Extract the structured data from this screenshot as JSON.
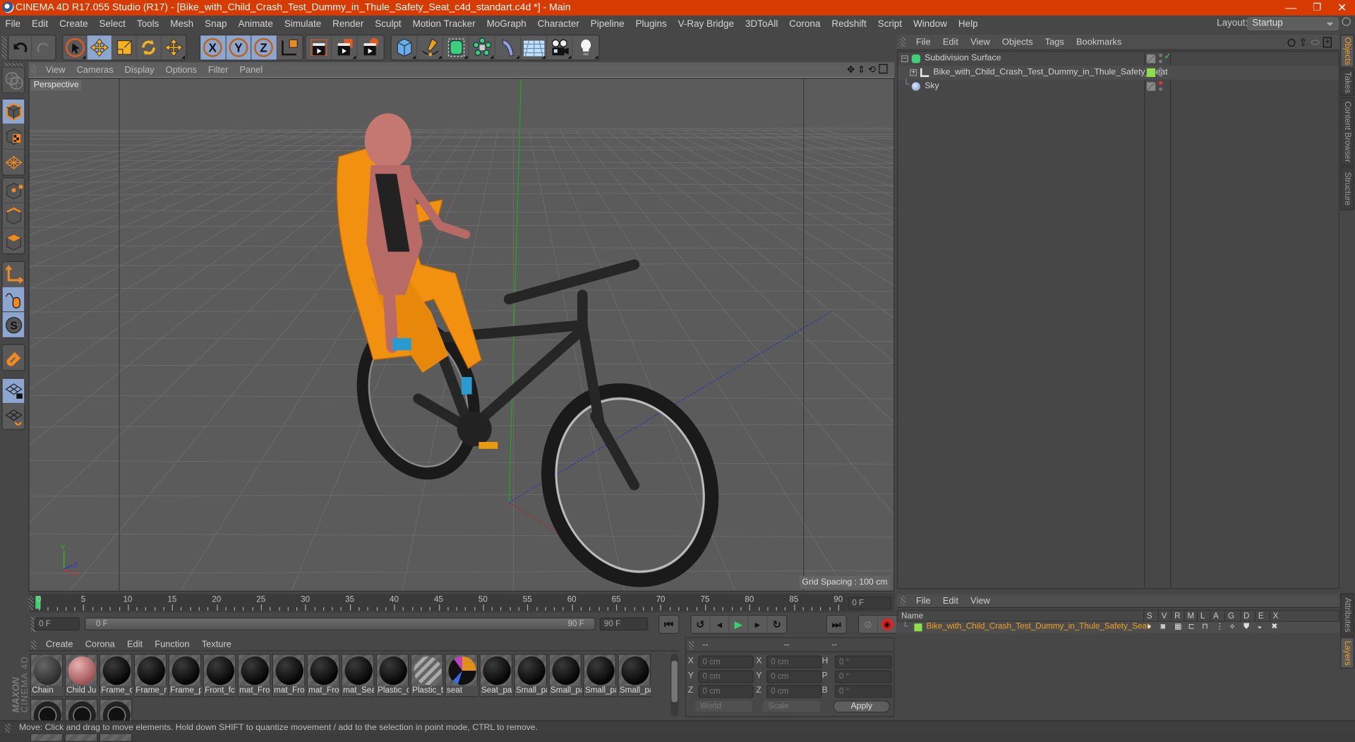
{
  "window": {
    "title": "CINEMA 4D R17.055 Studio (R17) - [Bike_with_Child_Crash_Test_Dummy_in_Thule_Safety_Seat_c4d_standart.c4d *] - Main",
    "controls": {
      "minimize": "—",
      "restore": "❐",
      "close": "✕"
    }
  },
  "menubar": {
    "items": [
      "File",
      "Edit",
      "Create",
      "Select",
      "Tools",
      "Mesh",
      "Snap",
      "Animate",
      "Simulate",
      "Render",
      "Sculpt",
      "Motion Tracker",
      "MoGraph",
      "Character",
      "Pipeline",
      "Plugins",
      "V-Ray Bridge",
      "3DToAll",
      "Corona",
      "Redshift",
      "Script",
      "Window",
      "Help"
    ],
    "layout_label": "Layout:",
    "layout_value": "Startup"
  },
  "toolbar": {
    "undo": "undo-icon",
    "redo": "redo-icon",
    "tools": [
      "select-arrow-icon",
      "move-icon",
      "scale-icon",
      "rotate-icon",
      "recent-tool-move-icon"
    ],
    "axis": [
      "X",
      "Y",
      "Z"
    ],
    "coordinate_system": "world-coordinate-icon",
    "render": [
      "render-view-icon",
      "render-picture-viewer-icon",
      "render-settings-icon"
    ],
    "create": [
      "cube-icon",
      "pen-spline-icon",
      "subdivision-icon",
      "cloner-icon",
      "deformer-icon",
      "floor-icon",
      "camera-icon",
      "light-icon"
    ]
  },
  "left_toolbar": [
    "make-editable-icon",
    "model-mode-icon",
    "texture-mode-icon",
    "workplane-icon",
    "points-mode-icon",
    "edges-mode-icon",
    "polygons-mode-icon",
    "axis-mode-icon",
    "tweak-mode-icon",
    "solo-icon",
    "snap-magnet-icon",
    "workplane-lock-icon",
    "workplane-align-icon"
  ],
  "viewport": {
    "menu": [
      "View",
      "Cameras",
      "Display",
      "Options",
      "Filter",
      "Panel"
    ],
    "camera_label": "Perspective",
    "grid_spacing": "Grid Spacing : 100 cm",
    "axis_labels": {
      "x": "X",
      "y": "Y",
      "z": "Z"
    }
  },
  "object_manager": {
    "menu": [
      "File",
      "Edit",
      "View",
      "Objects",
      "Tags",
      "Bookmarks"
    ],
    "objects": [
      {
        "name": "Subdivision Surface",
        "depth": 0,
        "expand": "−",
        "icon": "subdivision-surface-icon",
        "enabled_check": true
      },
      {
        "name": "Bike_with_Child_Crash_Test_Dummy_in_Thule_Safety_Seat",
        "depth": 1,
        "expand": "+",
        "icon": "null-object-icon",
        "layer_color": "#8ee04a"
      },
      {
        "name": "Sky",
        "depth": 0,
        "expand": "",
        "icon": "sky-icon",
        "red_dot": true
      }
    ]
  },
  "right_tabs": {
    "top": [
      {
        "label": "Objects",
        "active": true
      },
      {
        "label": "Takes",
        "active": false
      },
      {
        "label": "Content Browser",
        "active": false
      },
      {
        "label": "Structure",
        "active": false
      }
    ],
    "bottom": [
      {
        "label": "Attributes",
        "active": false
      },
      {
        "label": "Layers",
        "active": true
      }
    ]
  },
  "timeline": {
    "ticks": [
      "0",
      "5",
      "10",
      "15",
      "20",
      "25",
      "30",
      "35",
      "40",
      "45",
      "50",
      "55",
      "60",
      "65",
      "70",
      "75",
      "80",
      "85",
      "90"
    ],
    "current_frame_field": "0 F",
    "start_field": "0 F",
    "range_start": "0 F",
    "range_end": "90 F",
    "end_field": "90 F"
  },
  "playback": {
    "buttons": [
      "go-to-start-icon",
      "previous-key-icon",
      "previous-frame-icon",
      "play-icon",
      "next-frame-icon",
      "next-key-icon",
      "go-to-end-icon"
    ],
    "record": [
      "autokey-disabled-icon",
      "record-icon",
      "keyframe-help-icon"
    ],
    "key_tracks": [
      "key-position-icon",
      "key-scale-icon",
      "key-rotation-icon",
      "key-parameter-icon",
      "key-pla-icon"
    ],
    "timeline_button": "timeline-icon"
  },
  "material_manager": {
    "menu": [
      "Create",
      "Corona",
      "Edit",
      "Function",
      "Texture"
    ],
    "materials": [
      "Chain",
      "Child Ju",
      "Frame_c",
      "Frame_n",
      "Frame_p",
      "Front_fc",
      "mat_Fro",
      "mat_Fro",
      "mat_Fro",
      "mat_Sea",
      "Plastic_c",
      "Plastic_t",
      "seat",
      "Seat_pa",
      "Small_pa",
      "Small_pa",
      "Small_pa",
      "Small_pa",
      "",
      "",
      ""
    ]
  },
  "coordinates": {
    "headers": [
      "--",
      "--",
      "--"
    ],
    "rows": [
      {
        "a": "X",
        "av": "0 cm",
        "b": "X",
        "bv": "0 cm",
        "c": "H",
        "cv": "0 °"
      },
      {
        "a": "Y",
        "av": "0 cm",
        "b": "Y",
        "bv": "0 cm",
        "c": "P",
        "cv": "0 °"
      },
      {
        "a": "Z",
        "av": "0 cm",
        "b": "Z",
        "bv": "0 cm",
        "c": "B",
        "cv": "0 °"
      }
    ],
    "mode": "World",
    "transform": "Scale",
    "apply": "Apply"
  },
  "layer_manager": {
    "menu": [
      "File",
      "Edit",
      "View"
    ],
    "columns": [
      "Name",
      "S",
      "V",
      "R",
      "M",
      "L",
      "A",
      "G",
      "D",
      "E",
      "X"
    ],
    "layers": [
      {
        "name": "Bike_with_Child_Crash_Test_Dummy_in_Thule_Safety_Seat",
        "color": "#8ee04a"
      }
    ]
  },
  "status_bar": "Move: Click and drag to move elements. Hold down SHIFT to quantize movement / add to the selection in point mode, CTRL to remove.",
  "branding": {
    "maxon": "MAXON",
    "product": "CINEMA 4D"
  },
  "colors": {
    "title_bar": "#d83b01",
    "selected_tool": "#8ca6cf",
    "accent_orange": "#f0a020",
    "layer_name": "#f0a020"
  }
}
